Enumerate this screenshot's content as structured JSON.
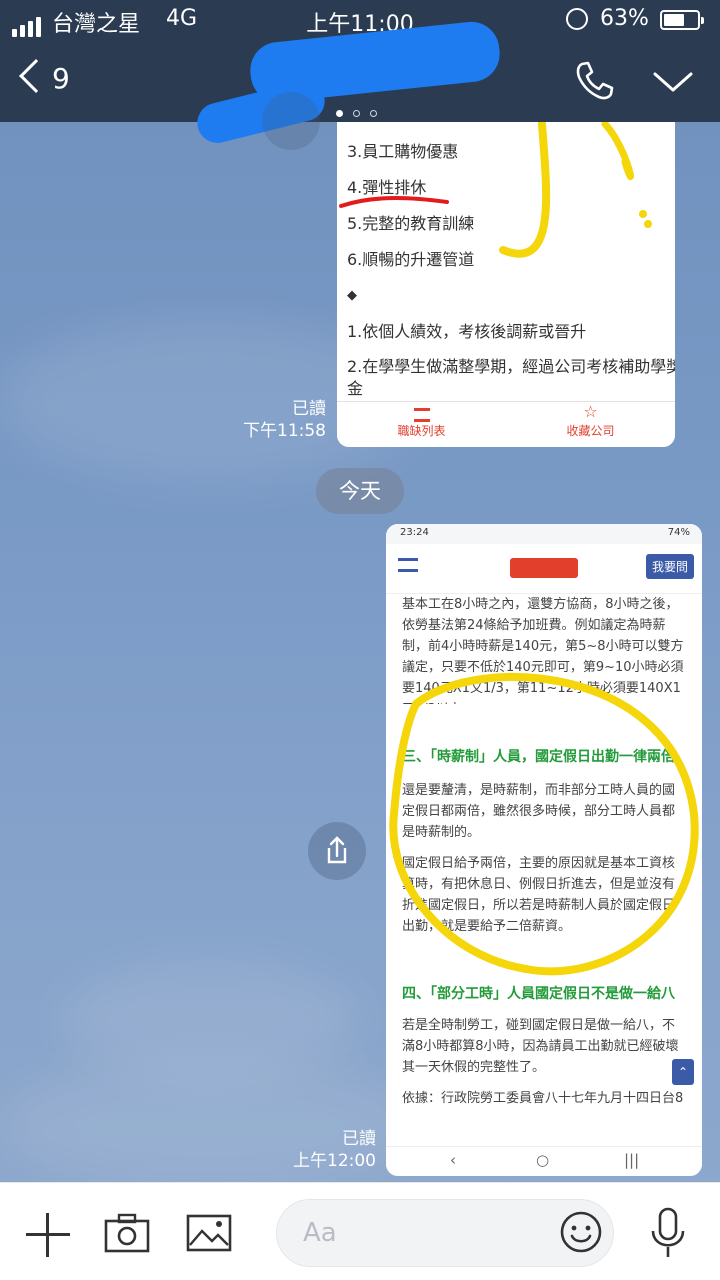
{
  "status_bar": {
    "carrier": "台灣之星",
    "network": "4G",
    "time": "上午11:00",
    "battery": "63%"
  },
  "header": {
    "unread_count": "9"
  },
  "messages": [
    {
      "items": [
        "3.員工購物優惠",
        "4.彈性排休",
        "5.完整的教育訓練",
        "6.順暢的升遷管道",
        "◆",
        "1.依個人績效，考核後調薪或晉升",
        "2.在學學生做滿整學期，經過公司考核補助學獎",
        "金"
      ],
      "footer": [
        "職缺列表",
        "收藏公司"
      ],
      "read": "已讀",
      "time": "下午11:58"
    },
    {
      "phone_time": "23:24",
      "phone_battery": "74%",
      "site_button": "我要問",
      "paragraphs": [
        "基本工在8小時之內，還雙方協商，8小時之後，依勞基法第24條給予加班費。例如議定為時薪制，前4小時時薪是140元，第5~8小時可以雙方議定，只要不低於140元即可，第9~10小時必須要140元X1又1/3，第11~12小時必須要140X1又2/3以上",
        "三、「時薪制」人員，國定假日出勤一律兩倍",
        "還是要釐清，是時薪制，而非部分工時人員的國定假日都兩倍，雖然很多時候，部分工時人員都是時薪制的。",
        "國定假日給予兩倍，主要的原因就是基本工資核算時，有把休息日、例假日折進去，但是並沒有折進國定假日，所以若是時薪制人員於國定假日出勤，就是要給予二倍薪資。",
        "四、「部分工時」人員國定假日不是做一給八",
        "若是全時制勞工，碰到國定假日是做一給八，不滿8小時都算8小時，因為請員工出勤就已經破壞其一天休假的完整性了。",
        "依據：行政院勞工委員會八十七年九月十四日台8"
      ],
      "read": "已讀",
      "time": "上午12:00"
    }
  ],
  "date_separator": "今天",
  "input": {
    "placeholder": "Aa"
  },
  "colors": {
    "header_bg": "#2b3b52",
    "highlight_yellow": "#f4d60a",
    "underline_red": "#e21c1c",
    "green_heading": "#239b3a"
  }
}
